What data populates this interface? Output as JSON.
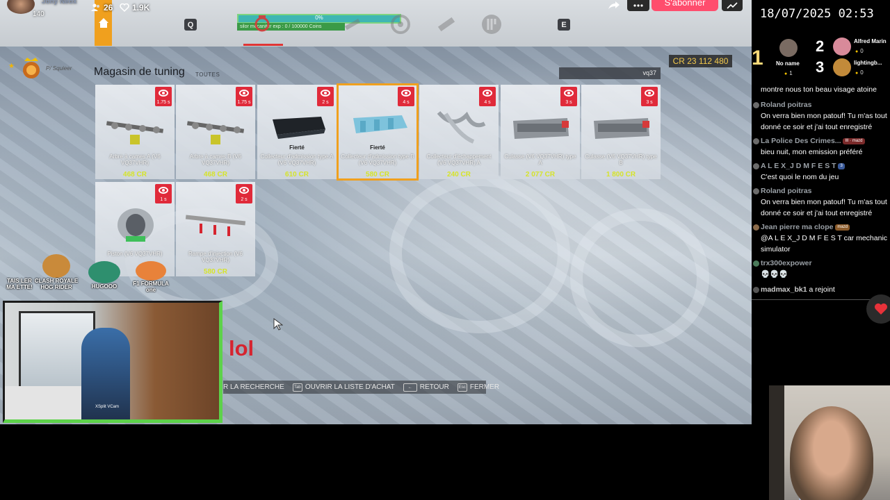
{
  "stream_overlay": {
    "name_partial": "Jony Neox",
    "viewers": "26",
    "likes": "1.9K",
    "sub_count": "140"
  },
  "stream_buttons": {
    "subscribe_label": "S'abonner"
  },
  "game": {
    "key_left": "Q",
    "key_right": "E",
    "progress": {
      "percent_label": "0%",
      "sub_label": "silor mécaniter exp : 0 / 100000 Coins",
      "fraction": 0.0
    },
    "player_name": "P/ Squieer",
    "shop_title": "Magasin de tuning",
    "shop_filter": "TOUTES",
    "search_value": "vq37",
    "credits": "CR 23 112 480",
    "items": [
      {
        "name": "Arbre à cames A (V6 VQ37VHR)",
        "price": "468 CR",
        "badge": "1.75 s",
        "brand": ""
      },
      {
        "name": "Arbre à cames B (V6 VQ37VHR)",
        "price": "468 CR",
        "badge": "1.75 s",
        "brand": ""
      },
      {
        "name": "Collecteur d'admission type A (V6 VQ37VHR)",
        "price": "610 CR",
        "badge": "2 s",
        "brand": "Fierté"
      },
      {
        "name": "Collecteur d'admission type B (V6 VQ37VHR)",
        "price": "580 CR",
        "badge": "4 s",
        "brand": "Fierté"
      },
      {
        "name": "Collecteur d'échappement (V6 VQ37VHR) A",
        "price": "240 CR",
        "badge": "4 s",
        "brand": ""
      },
      {
        "name": "Culasse (V6 VQ37VHR) type A",
        "price": "2 077 CR",
        "badge": "3 s",
        "brand": ""
      },
      {
        "name": "Culasse (V6 VQ37VHR) type B",
        "price": "1 800 CR",
        "badge": "3 s",
        "brand": ""
      },
      {
        "name": "Piston (V6 VQ37VHR)",
        "price": "",
        "badge": "1 s",
        "brand": ""
      },
      {
        "name": "Rampe d'injection (V6 VQ37VHR)",
        "price": "580 CR",
        "badge": "2 s",
        "brand": ""
      }
    ],
    "hints": [
      {
        "key": "",
        "label": "R LA RECHERCHE"
      },
      {
        "key": "Tab",
        "label": "OUVRIR LA LISTE D'ACHAT"
      },
      {
        "key": "←",
        "label": "RETOUR"
      },
      {
        "key": "Esc",
        "label": "FERMER"
      }
    ]
  },
  "stream_text": {
    "lol": "lol"
  },
  "emotes": [
    {
      "label": "TAIS LER MA ETTE!",
      "color": "#d9822b"
    },
    {
      "label": "CLASH ROYALE HOG RIDER",
      "color": "#c98a3a"
    },
    {
      "label": "HUGOOO",
      "color": "#3aa07a"
    },
    {
      "label": "F1 FORMULA one",
      "color": "#e8823a"
    }
  ],
  "webcam": {
    "label": "XSplit VCam"
  },
  "right_panel": {
    "clock": "18/07/2025 02:53",
    "leaders": [
      {
        "rank": "1",
        "name": "No name",
        "count": "1",
        "color": "#7a6b62"
      },
      {
        "rank": "2",
        "name": "Alfred Marin",
        "count": "0",
        "color": "#d88a9a"
      },
      {
        "rank": "3",
        "name": "lightingb...",
        "count": "0",
        "color": "#c28a3a"
      }
    ],
    "chat": [
      {
        "user": "",
        "text": "montre nous ton beau visage atoine",
        "dot": "",
        "badge": ""
      },
      {
        "user": "Roland poitras",
        "text": "On verra bien mon patouf! Tu m'as tout donné ce soir et j'ai tout enregistré",
        "dot": "#6b6b6b",
        "badge": ""
      },
      {
        "user": "La Police Des Crimes...",
        "text": "bieu nuit, mon emission préféré",
        "dot": "#6b6b6b",
        "badge": "III · mazd"
      },
      {
        "user": "A L E X_J D M F E S T",
        "text": "C'est quoi le nom du jeu",
        "dot": "#6b6b6b",
        "badge": "3"
      },
      {
        "user": "Roland poitras",
        "text": "On verra bien mon patouf! Tu m'as tout donné ce soir et j'ai tout enregistré",
        "dot": "#6b6b6b",
        "badge": ""
      },
      {
        "user": "Jean pierre ma clope",
        "text": "@A L E X_J D M F E S T car mechanic simulator",
        "dot": "#8a6a4a",
        "badge": "mazd"
      },
      {
        "user": "trx300expower",
        "text": "💀💀💀",
        "dot": "#4a7a5a",
        "badge": ""
      }
    ],
    "join": {
      "user": "madmax_bk1",
      "text": "a rejoint"
    }
  }
}
